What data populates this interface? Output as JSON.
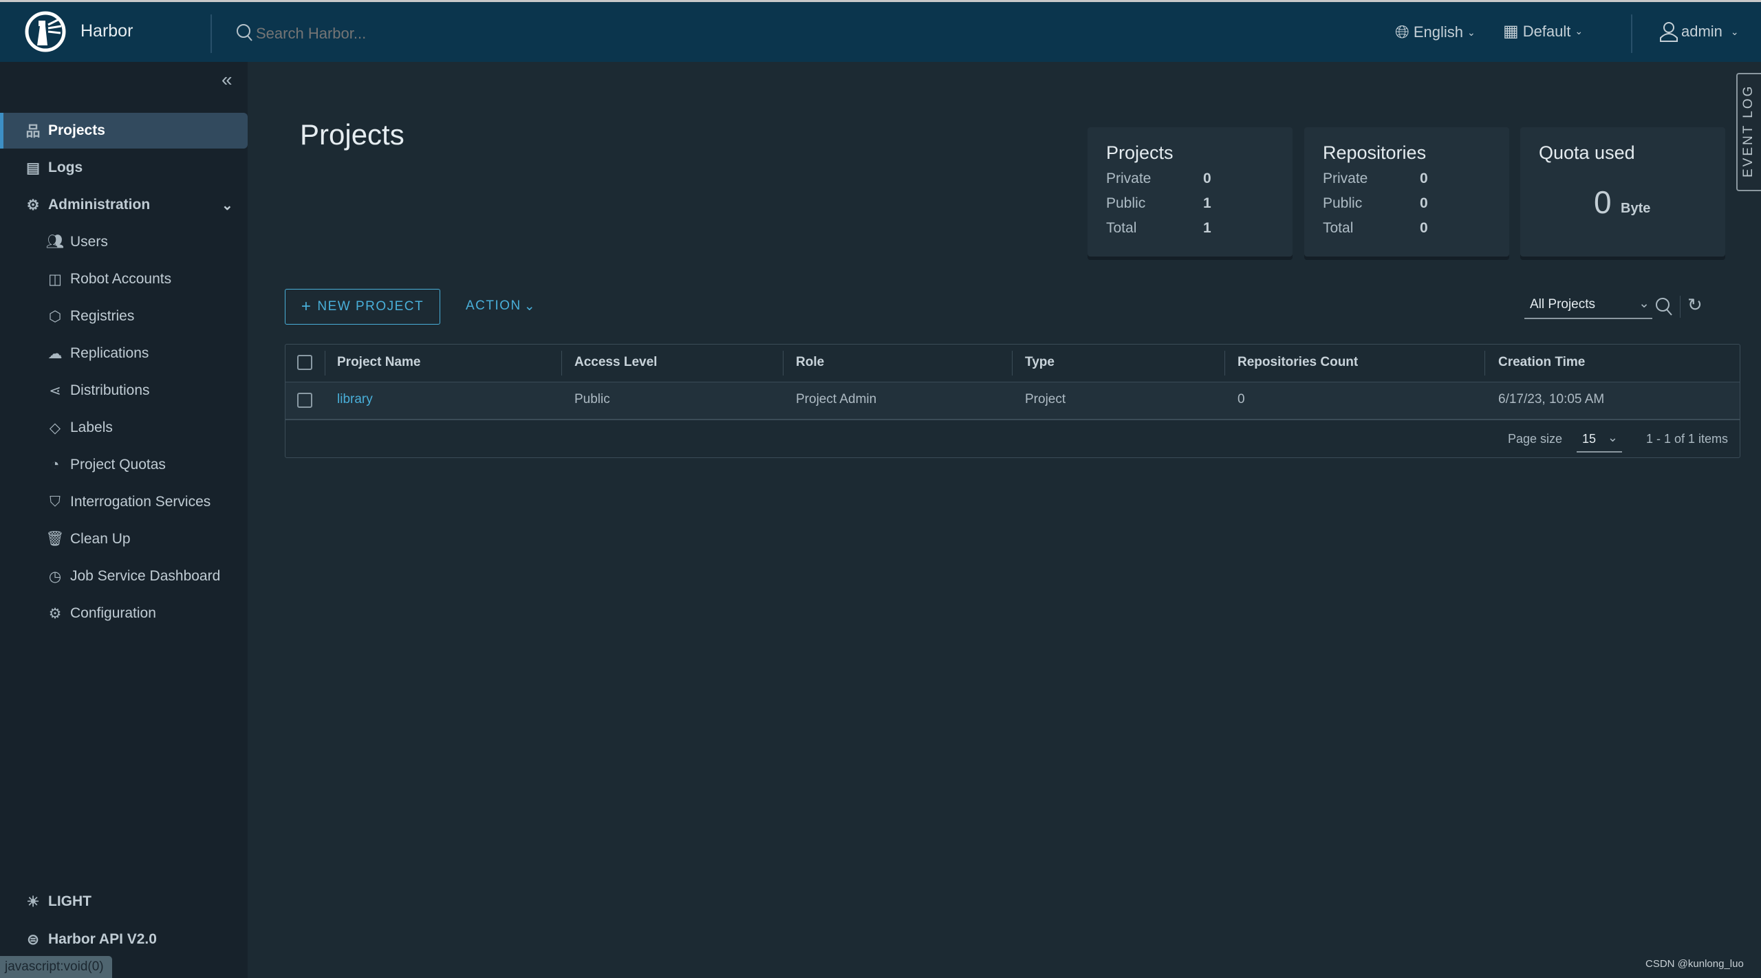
{
  "header": {
    "app_name": "Harbor",
    "search_placeholder": "Search Harbor...",
    "language": "English",
    "datetime_format": "Default",
    "user": "admin"
  },
  "sidebar": {
    "items": [
      {
        "label": "Projects",
        "icon": "projects-icon",
        "active": true
      },
      {
        "label": "Logs",
        "icon": "logs-icon"
      },
      {
        "label": "Administration",
        "icon": "administration-icon",
        "expanded": true
      }
    ],
    "admin_items": [
      {
        "label": "Users",
        "icon": "users-icon"
      },
      {
        "label": "Robot Accounts",
        "icon": "robot-icon"
      },
      {
        "label": "Registries",
        "icon": "registries-icon"
      },
      {
        "label": "Replications",
        "icon": "replications-icon"
      },
      {
        "label": "Distributions",
        "icon": "distributions-icon"
      },
      {
        "label": "Labels",
        "icon": "tag-icon"
      },
      {
        "label": "Project Quotas",
        "icon": "quota-icon"
      },
      {
        "label": "Interrogation Services",
        "icon": "shield-icon"
      },
      {
        "label": "Clean Up",
        "icon": "trash-icon"
      },
      {
        "label": "Job Service Dashboard",
        "icon": "dashboard-icon"
      },
      {
        "label": "Configuration",
        "icon": "gear-icon"
      }
    ],
    "theme_toggle": "LIGHT",
    "api_link": "Harbor API V2.0"
  },
  "main": {
    "title": "Projects",
    "cards": {
      "projects": {
        "title": "Projects",
        "private_label": "Private",
        "private": "0",
        "public_label": "Public",
        "public": "1",
        "total_label": "Total",
        "total": "1"
      },
      "repositories": {
        "title": "Repositories",
        "private_label": "Private",
        "private": "0",
        "public_label": "Public",
        "public": "0",
        "total_label": "Total",
        "total": "0"
      },
      "quota": {
        "title": "Quota used",
        "value": "0",
        "unit": "Byte"
      }
    },
    "new_project": "NEW PROJECT",
    "action": "ACTION",
    "filter": "All Projects",
    "table": {
      "columns": [
        "Project Name",
        "Access Level",
        "Role",
        "Type",
        "Repositories Count",
        "Creation Time"
      ],
      "rows": [
        [
          "library",
          "Public",
          "Project Admin",
          "Project",
          "0",
          "6/17/23, 10:05 AM"
        ]
      ],
      "page_size_label": "Page size",
      "page_size": "15",
      "pagination": "1 - 1 of 1 items"
    }
  },
  "event_log": "EVENT LOG",
  "status_bar": "javascript:void(0)",
  "watermark": "CSDN @kunlong_luo",
  "colors": {
    "header": "#0b354d",
    "sidebar": "#17222b",
    "main": "#1c2a33",
    "accent": "#49afd9"
  }
}
